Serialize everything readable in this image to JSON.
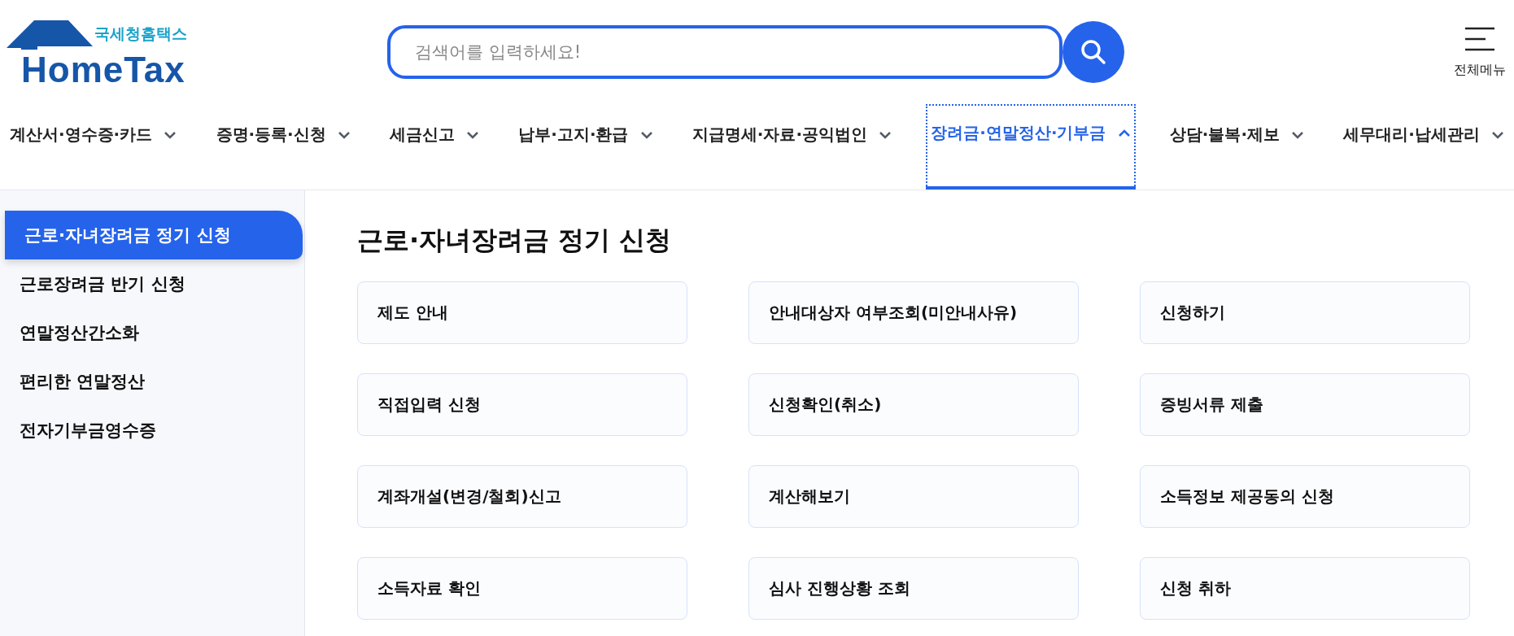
{
  "logo": {
    "subtitle": "국세청홈택스",
    "name": "HomeTax"
  },
  "search": {
    "placeholder": "검색어를 입력하세요!"
  },
  "menu_button": {
    "label": "전체메뉴"
  },
  "nav": [
    {
      "label": "계산서·영수증·카드",
      "selected": false
    },
    {
      "label": "증명·등록·신청",
      "selected": false
    },
    {
      "label": "세금신고",
      "selected": false
    },
    {
      "label": "납부·고지·환급",
      "selected": false
    },
    {
      "label": "지급명세·자료·공익법인",
      "selected": false
    },
    {
      "label": "장려금·연말정산·기부금",
      "selected": true
    },
    {
      "label": "상담·불복·제보",
      "selected": false
    },
    {
      "label": "세무대리·납세관리",
      "selected": false
    }
  ],
  "sidebar": {
    "items": [
      {
        "label": "근로·자녀장려금 정기 신청",
        "selected": true
      },
      {
        "label": "근로장려금 반기 신청",
        "selected": false
      },
      {
        "label": "연말정산간소화",
        "selected": false
      },
      {
        "label": "편리한 연말정산",
        "selected": false
      },
      {
        "label": "전자기부금영수증",
        "selected": false
      }
    ]
  },
  "content": {
    "title": "근로·자녀장려금 정기 신청",
    "cards": [
      "제도 안내",
      "안내대상자 여부조회(미안내사유)",
      "신청하기",
      "직접입력 신청",
      "신청확인(취소)",
      "증빙서류 제출",
      "계좌개설(변경/철회)신고",
      "계산해보기",
      "소득정보 제공동의 신청",
      "소득자료 확인",
      "심사 진행상황 조회",
      "신청 취하"
    ]
  }
}
